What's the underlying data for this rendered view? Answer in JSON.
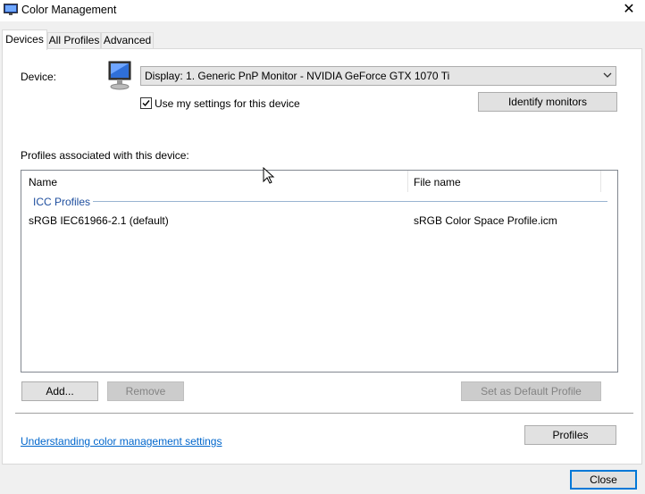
{
  "window": {
    "title": "Color Management",
    "close_glyph": "✕"
  },
  "tabs": [
    {
      "label": "Devices",
      "active": true
    },
    {
      "label": "All Profiles",
      "active": false
    },
    {
      "label": "Advanced",
      "active": false
    }
  ],
  "device": {
    "label": "Device:",
    "selected": "Display: 1. Generic PnP Monitor - NVIDIA GeForce GTX 1070 Ti",
    "use_my_settings_label": "Use my settings for this device",
    "use_my_settings_checked": true,
    "identify_monitors_label": "Identify monitors"
  },
  "profiles": {
    "section_label": "Profiles associated with this device:",
    "columns": [
      "Name",
      "File name"
    ],
    "group_label": "ICC Profiles",
    "rows": [
      {
        "name": "sRGB IEC61966-2.1 (default)",
        "file": "sRGB Color Space Profile.icm"
      }
    ]
  },
  "buttons": {
    "add": "Add...",
    "remove": "Remove",
    "set_default": "Set as Default Profile",
    "profiles": "Profiles",
    "close": "Close"
  },
  "footer": {
    "link": "Understanding color management settings"
  },
  "colors": {
    "accent": "#0078d7",
    "link": "#0066cc",
    "group_header": "#1e4e9e"
  }
}
